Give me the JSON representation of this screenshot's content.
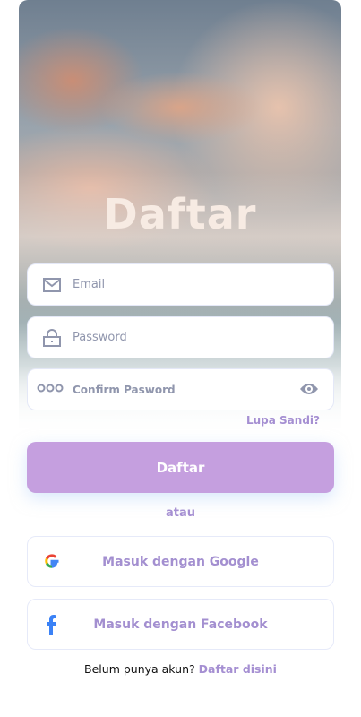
{
  "title": "Daftar",
  "fields": {
    "email": {
      "placeholder": "Email",
      "icon": "mail-icon"
    },
    "password": {
      "placeholder": "Password",
      "icon": "lock-icon"
    },
    "confirm": {
      "placeholder": "Confirm Pasword",
      "icon": "dots-icon",
      "toggle_icon": "eye-icon"
    }
  },
  "forgot": "Lupa Sandi?",
  "submit": "Daftar",
  "divider": "atau",
  "google": "Masuk dengan Google",
  "facebook": "Masuk dengan Facebook",
  "footer": {
    "text": "Belum punya akun?",
    "link": "Daftar disini"
  },
  "colors": {
    "accent": "#c59fdf",
    "link": "#a58fd2",
    "facebook": "#3b82f6"
  }
}
